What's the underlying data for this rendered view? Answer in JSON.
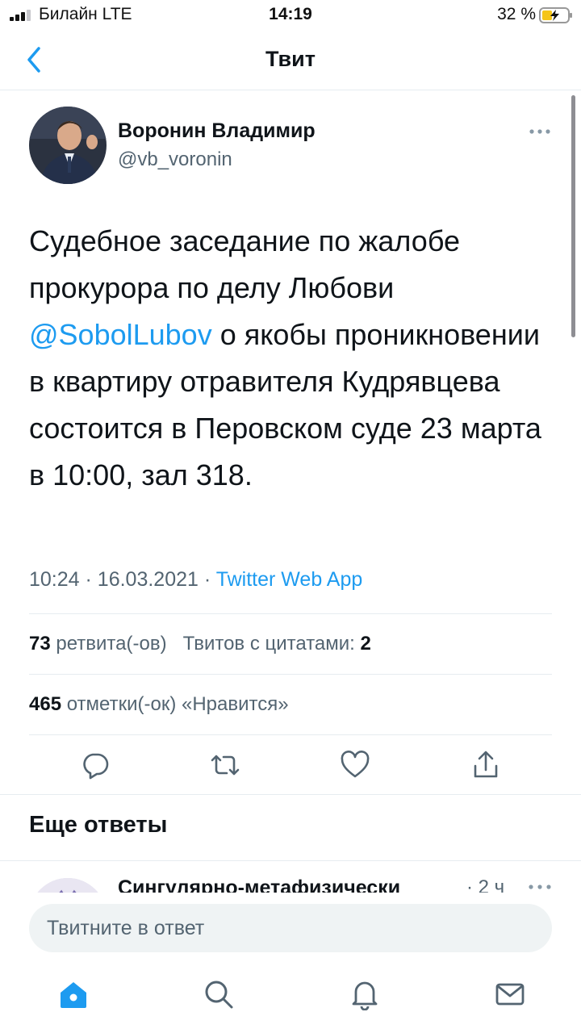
{
  "status_bar": {
    "carrier": "Билайн  LTE",
    "time": "14:19",
    "battery_percent": "32 %"
  },
  "nav": {
    "title": "Твит",
    "back_icon": "chevron-left-icon"
  },
  "tweet": {
    "author_name": "Воронин Владимир",
    "author_handle": "@vb_voronin",
    "text_before_mention": "Судебное заседание по жалобе прокурора по делу Любови ",
    "mention": "@SobolLubov",
    "text_after_mention": " о якобы проникновении в квартиру отравителя Кудрявцева состоится в Перовском суде 23 марта в 10:00, зал 318.",
    "time": "10:24",
    "separator": "·",
    "date": "16.03.2021",
    "source": "Twitter Web App"
  },
  "stats": {
    "retweets_count": "73",
    "retweets_label": "ретвита(-ов)",
    "quotes_label": "Твитов с цитатами:",
    "quotes_count": "2",
    "likes_count": "465",
    "likes_label": "отметки(-ок) «Нравится»"
  },
  "actions": [
    "reply-icon",
    "retweet-icon",
    "like-icon",
    "share-icon"
  ],
  "replies": {
    "section_title": "Еще ответы",
    "first_reply_name": "Сингулярно-метафизически",
    "first_reply_time": "· 2 ч"
  },
  "composer": {
    "placeholder": "Твитните в ответ"
  },
  "tabs": [
    "home-icon",
    "search-icon",
    "notifications-icon",
    "messages-icon"
  ],
  "colors": {
    "accent": "#1d9bf0",
    "text": "#0f1419",
    "secondary_text": "#536471"
  }
}
